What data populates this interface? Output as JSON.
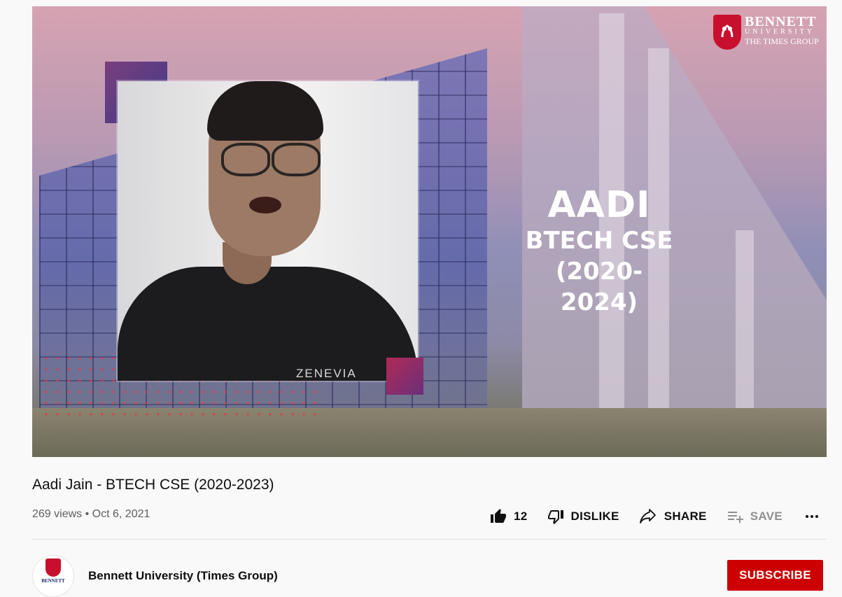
{
  "video": {
    "overlay_name": "AADI",
    "overlay_program": "BTECH CSE",
    "overlay_years": "(2020-2024)",
    "logo_line1": "BENNETT",
    "logo_line2": "UNIVERSITY",
    "logo_line3": "THE TIMES GROUP",
    "shirt_text": "ZENEVIA"
  },
  "title": "Aadi Jain - BTECH CSE (2020-2023)",
  "meta": {
    "views": "269 views",
    "separator": "•",
    "date": "Oct 6, 2021"
  },
  "actions": {
    "like_count": "12",
    "dislike_label": "DISLIKE",
    "share_label": "SHARE",
    "save_label": "SAVE",
    "more_icon": "more-horizontal-icon"
  },
  "channel": {
    "name": "Bennett University (Times Group)",
    "avatar_text": "BENNETT",
    "subscribe_label": "SUBSCRIBE"
  },
  "colors": {
    "subscribe_bg": "#cc0000",
    "brand_red": "#c8102e"
  }
}
